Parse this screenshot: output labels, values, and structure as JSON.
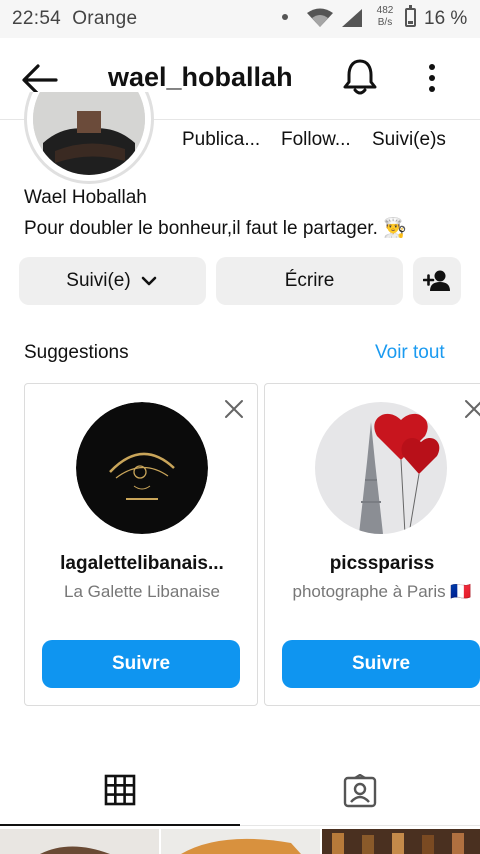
{
  "status_bar": {
    "time": "22:54",
    "carrier": "Orange",
    "data_rate_value": "482",
    "data_rate_unit": "B/s",
    "battery": "16 %"
  },
  "header": {
    "username": "wael_hoballah",
    "icons": [
      "arrow-left-icon",
      "bell-icon",
      "more-vertical-icon"
    ]
  },
  "profile": {
    "stats": [
      "Publica...",
      "Follow...",
      "Suivi(e)s"
    ],
    "full_name": "Wael Hoballah",
    "bio": "Pour doubler le bonheur,il faut le partager. 👨‍🍳"
  },
  "actions": {
    "following_label": "Suivi(e)",
    "message_label": "Écrire",
    "icons": [
      "chevron-down-icon",
      "add-user-icon"
    ]
  },
  "suggestions": {
    "title": "Suggestions",
    "see_all": "Voir tout",
    "cards": [
      {
        "name": "lagalettelibanais...",
        "subtitle": "La Galette Libanaise",
        "button": "Suivre"
      },
      {
        "name": "picsspariss",
        "subtitle": "photographe à Paris 🇫🇷",
        "button": "Suivre"
      }
    ]
  },
  "tabs": [
    "grid-icon",
    "tagged-icon"
  ],
  "colors": {
    "accent": "#0f95f0",
    "link": "#1a9af0",
    "button_grey": "#efefef"
  }
}
